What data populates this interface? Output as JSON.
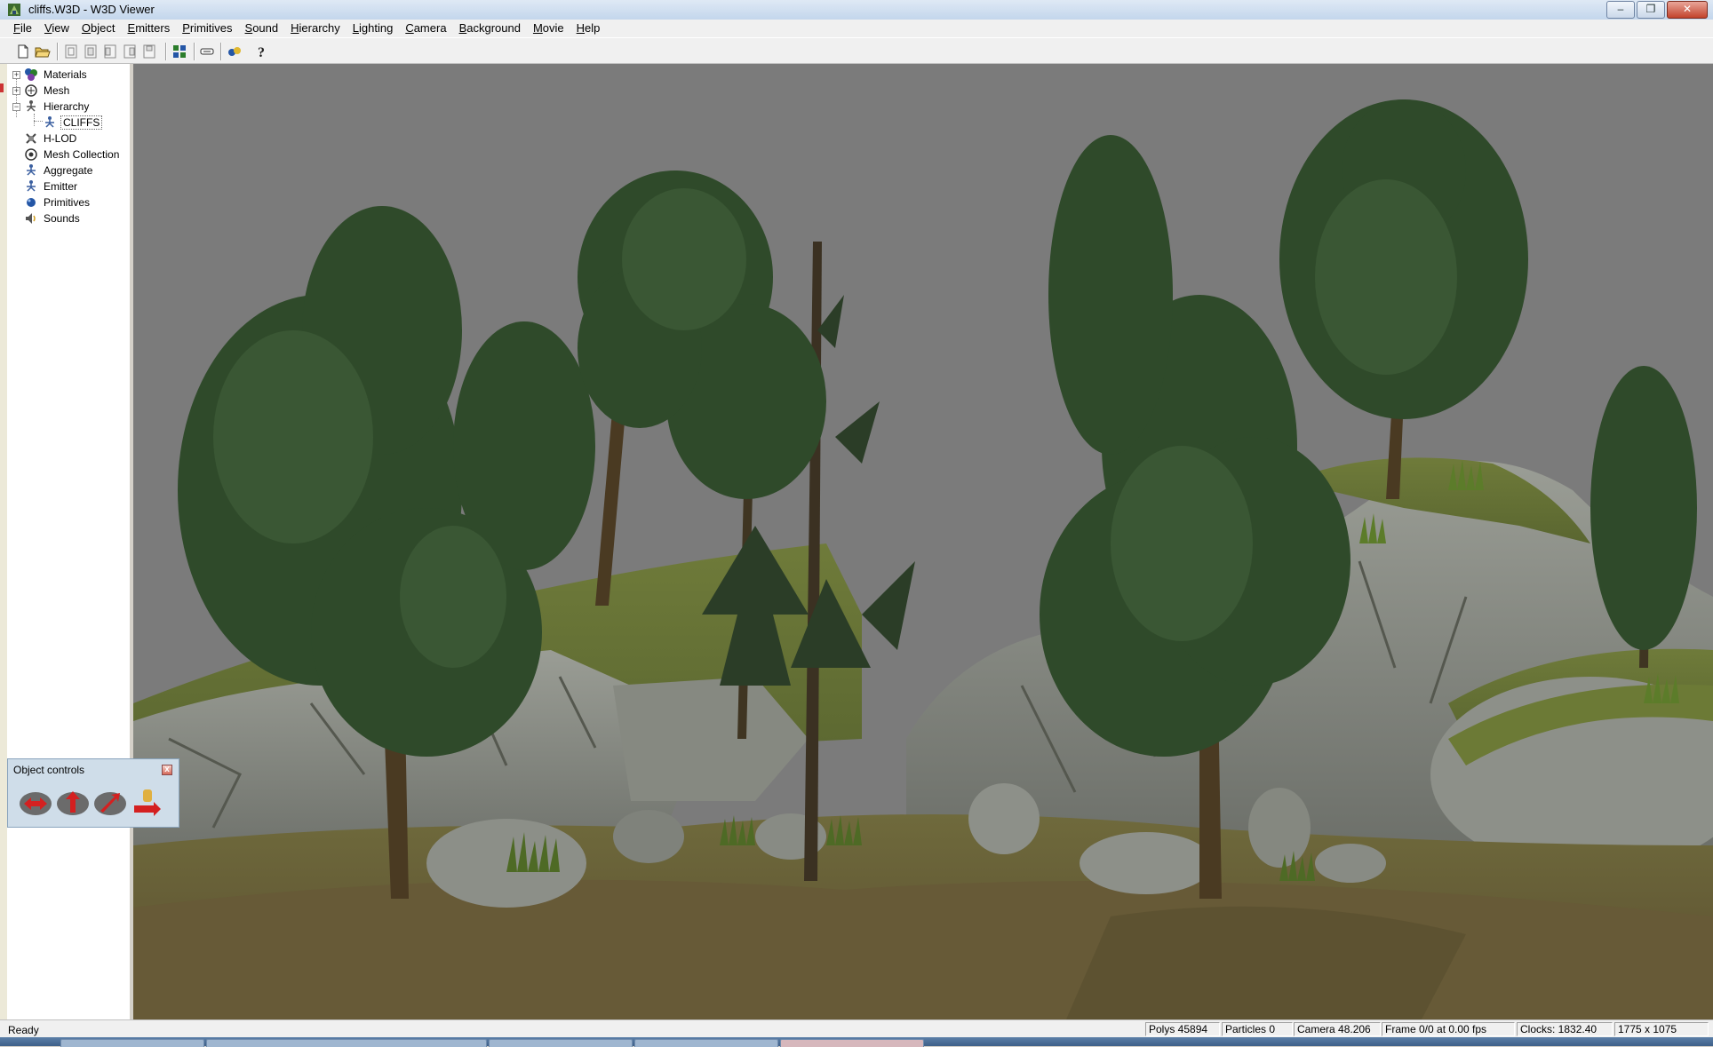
{
  "window": {
    "title": "cliffs.W3D - W3D Viewer",
    "minimize_glyph": "–",
    "maximize_glyph": "❐",
    "close_glyph": "✕"
  },
  "menu": {
    "items": [
      {
        "underline": "F",
        "rest": "ile"
      },
      {
        "underline": "V",
        "rest": "iew"
      },
      {
        "underline": "O",
        "rest": "bject"
      },
      {
        "underline": "E",
        "rest": "mitters"
      },
      {
        "underline": "P",
        "rest": "rimitives"
      },
      {
        "underline": "S",
        "rest": "ound"
      },
      {
        "underline": "H",
        "rest": "ierarchy"
      },
      {
        "underline": "L",
        "rest": "ighting"
      },
      {
        "underline": "C",
        "rest": "amera"
      },
      {
        "underline": "B",
        "rest": "ackground"
      },
      {
        "underline": "M",
        "rest": "ovie"
      },
      {
        "underline": "H",
        "rest": "elp"
      }
    ]
  },
  "toolbar": {
    "icons": [
      "new-file-icon",
      "open-folder-icon",
      "camera-front-icon",
      "camera-back-icon",
      "camera-left-icon",
      "camera-right-icon",
      "camera-top-icon",
      "object-rotate-icon",
      "toggle-sky-icon",
      "animation-icon",
      "help-icon"
    ]
  },
  "tree": {
    "items": [
      {
        "label": "Materials",
        "toggle": "+",
        "icon": "materials-icon"
      },
      {
        "label": "Mesh",
        "toggle": "+",
        "icon": "mesh-icon"
      },
      {
        "label": "Hierarchy",
        "toggle": "−",
        "icon": "hierarchy-icon"
      },
      {
        "label": "CLIFFS",
        "toggle": "",
        "icon": "hierarchy-child-icon"
      },
      {
        "label": "H-LOD",
        "toggle": "",
        "icon": "hlod-icon"
      },
      {
        "label": "Mesh Collection",
        "toggle": "",
        "icon": "mesh-collection-icon"
      },
      {
        "label": "Aggregate",
        "toggle": "",
        "icon": "aggregate-icon"
      },
      {
        "label": "Emitter",
        "toggle": "",
        "icon": "emitter-icon"
      },
      {
        "label": "Primitives",
        "toggle": "",
        "icon": "primitives-icon"
      },
      {
        "label": "Sounds",
        "toggle": "",
        "icon": "sounds-icon"
      }
    ]
  },
  "object_controls": {
    "title": "Object controls",
    "close_glyph": "x"
  },
  "status": {
    "ready": "Ready",
    "polys": "Polys 45894",
    "particles": "Particles 0",
    "camera": "Camera 48.206",
    "frame": "Frame 0/0 at 0.00 fps",
    "clocks": "Clocks: 1832.40",
    "resolution": "1775 x 1075"
  },
  "colors": {
    "sky": "#7b7b7b",
    "foliage": "#2f4a2a",
    "rock": "#8a8d86",
    "ground": "#6e6440",
    "grass": "#5e6e2e"
  }
}
